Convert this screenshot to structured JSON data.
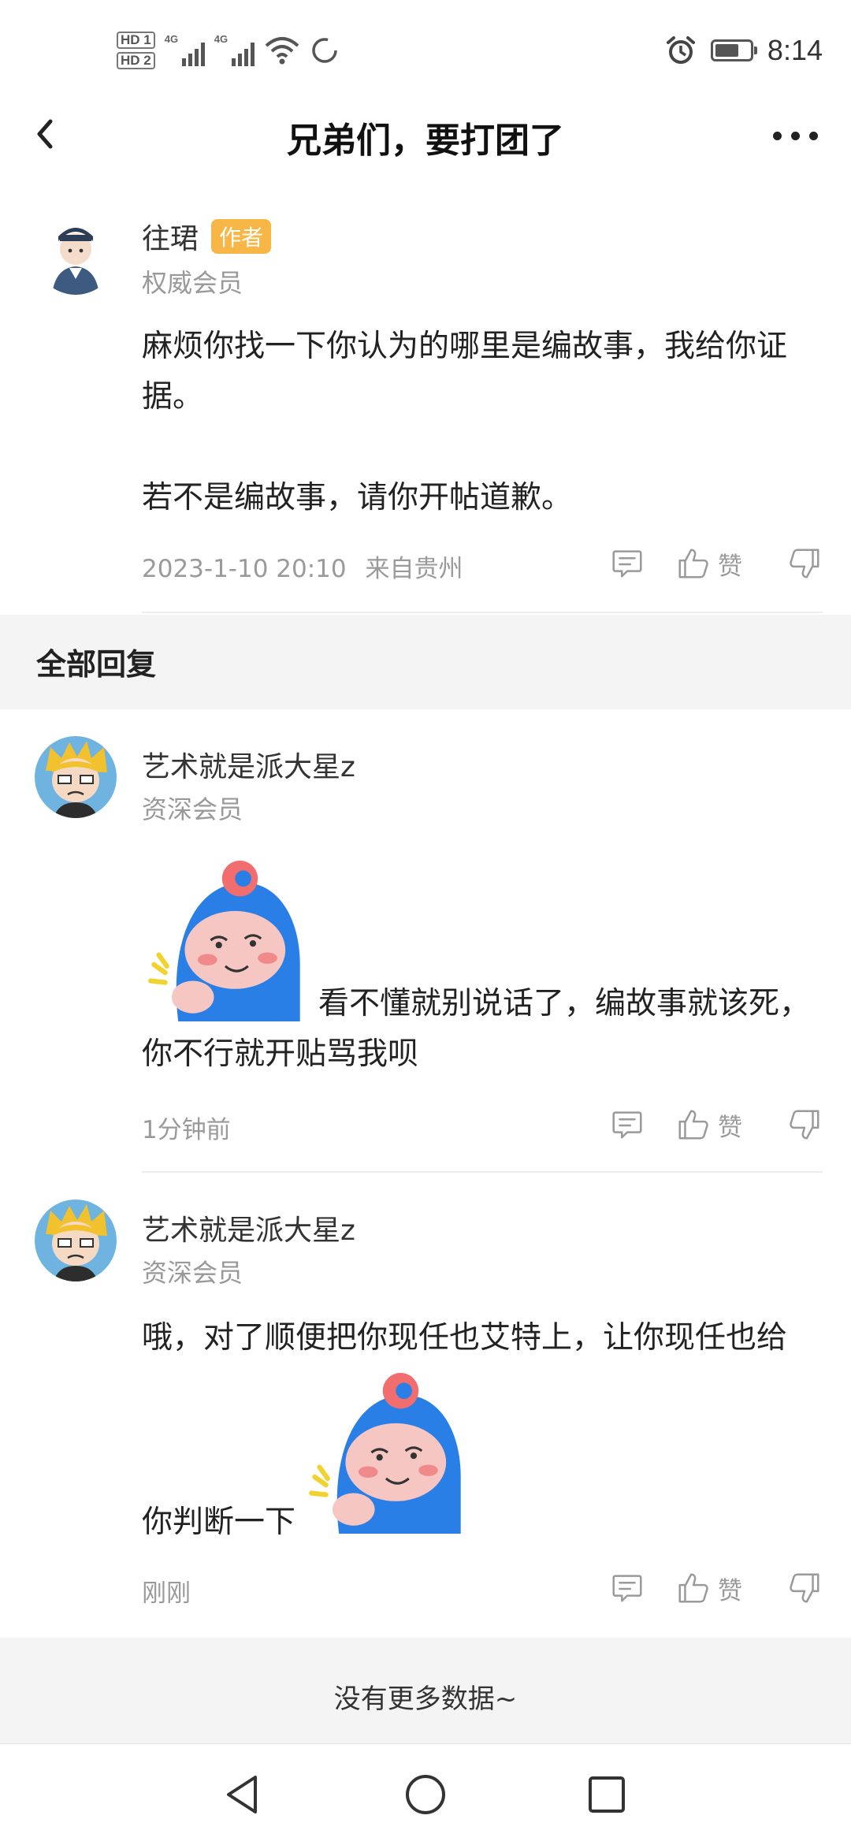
{
  "status_bar": {
    "hd1": "HD 1",
    "hd2": "HD 2",
    "net1": "4G",
    "net2": "4G",
    "time": "8:14",
    "battery_level": 0.7
  },
  "header": {
    "title": "兄弟们，要打团了"
  },
  "main_post": {
    "username": "往珺",
    "author_badge": "作者",
    "member_level": "权威会员",
    "text_line1": "麻烦你找一下你认为的哪里是编故事，我给你证据。",
    "text_line2": "若不是编故事，请你开帖道歉。",
    "timestamp": "2023-1-10 20:10",
    "location": "来自贵州",
    "like_label": "赞"
  },
  "replies_section": {
    "title": "全部回复"
  },
  "replies": [
    {
      "username": "艺术就是派大星z",
      "member_level": "资深会员",
      "text": "看不懂就别说话了，编故事就该死，你不行就开贴骂我呗",
      "timestamp": "1分钟前",
      "like_label": "赞"
    },
    {
      "username": "艺术就是派大星z",
      "member_level": "资深会员",
      "text_before": "哦，对了顺便把你现任也艾特上，让你现任也给",
      "text_after": "你判断一下",
      "timestamp": "刚刚",
      "like_label": "赞"
    }
  ],
  "footer": {
    "no_more": "没有更多数据~"
  },
  "icons": {
    "back": "chevron-left-icon",
    "more": "more-dots-icon",
    "comment": "comment-icon",
    "like": "thumbs-up-icon",
    "dislike": "thumbs-down-icon",
    "nav_back": "triangle-back-icon",
    "nav_home": "circle-home-icon",
    "nav_recent": "square-recent-icon"
  },
  "colors": {
    "author_badge": "#f7b645",
    "sticker_blue": "#2a7fe6"
  }
}
